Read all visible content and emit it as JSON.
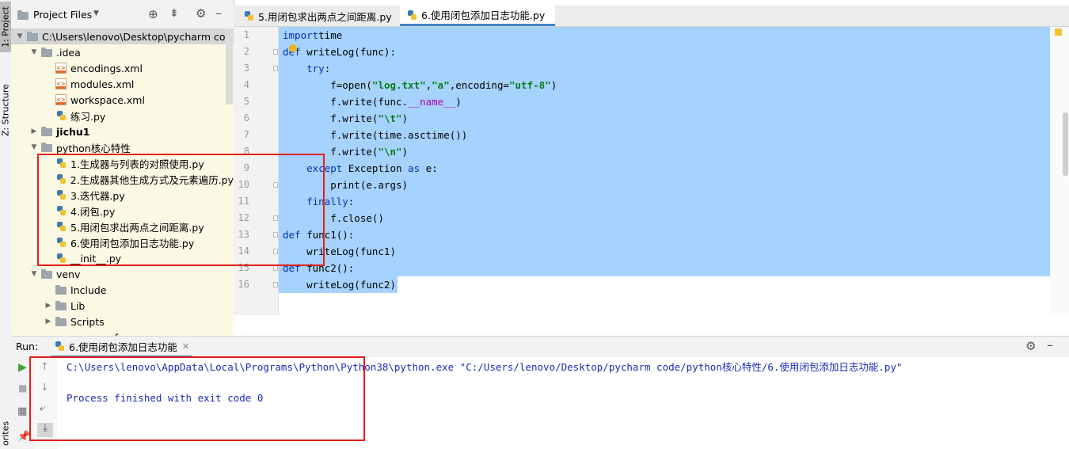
{
  "left_strip": {
    "project_tab": "1: Project",
    "structure_tab": "Z: Structure",
    "favorites_tab": "orites"
  },
  "project_panel": {
    "title": "Project Files",
    "tree": [
      {
        "label": "C:\\Users\\lenovo\\Desktop\\pycharm cod",
        "icon": "folder-icon",
        "indent": 0,
        "arrow": "down",
        "selected": true
      },
      {
        "label": ".idea",
        "icon": "folder-icon",
        "indent": 1,
        "arrow": "down"
      },
      {
        "label": "encodings.xml",
        "icon": "xml-file-icon",
        "indent": 2,
        "arrow": ""
      },
      {
        "label": "modules.xml",
        "icon": "xml-file-icon",
        "indent": 2,
        "arrow": ""
      },
      {
        "label": "workspace.xml",
        "icon": "xml-file-icon",
        "indent": 2,
        "arrow": ""
      },
      {
        "label": "练习.py",
        "icon": "python-file-icon",
        "indent": 2,
        "arrow": ""
      },
      {
        "label": "jichu1",
        "icon": "folder-icon",
        "indent": 1,
        "arrow": "right",
        "bold": true
      },
      {
        "label": "python核心特性",
        "icon": "folder-icon",
        "indent": 1,
        "arrow": "down"
      },
      {
        "label": "1.生成器与列表的对照使用.py",
        "icon": "python-file-icon",
        "indent": 2,
        "arrow": ""
      },
      {
        "label": "2.生成器其他生成方式及元素遍历.py",
        "icon": "python-file-icon",
        "indent": 2,
        "arrow": ""
      },
      {
        "label": "3.迭代器.py",
        "icon": "python-file-icon",
        "indent": 2,
        "arrow": ""
      },
      {
        "label": "4.闭包.py",
        "icon": "python-file-icon",
        "indent": 2,
        "arrow": ""
      },
      {
        "label": "5.用闭包求出两点之间距离.py",
        "icon": "python-file-icon",
        "indent": 2,
        "arrow": ""
      },
      {
        "label": "6.使用闭包添加日志功能.py",
        "icon": "python-file-icon",
        "indent": 2,
        "arrow": ""
      },
      {
        "label": "__init__.py",
        "icon": "python-file-icon",
        "indent": 2,
        "arrow": ""
      },
      {
        "label": "venv",
        "icon": "folder-icon",
        "indent": 1,
        "arrow": "down"
      },
      {
        "label": "Include",
        "icon": "folder-icon",
        "indent": 2,
        "arrow": ""
      },
      {
        "label": "Lib",
        "icon": "folder-icon",
        "indent": 2,
        "arrow": "right"
      },
      {
        "label": "Scripts",
        "icon": "folder-icon",
        "indent": 2,
        "arrow": "right"
      },
      {
        "label": "pyvenv.cfg",
        "icon": "file-icon",
        "indent": 2,
        "arrow": ""
      }
    ]
  },
  "editor": {
    "tabs": [
      {
        "label": "5.用闭包求出两点之间距离.py",
        "active": false
      },
      {
        "label": "6.使用闭包添加日志功能.py",
        "active": true
      }
    ],
    "lines": [
      [
        [
          "kw",
          "import"
        ],
        [
          "",
          "time"
        ]
      ],
      [
        [
          "kw",
          "def"
        ],
        [
          "",
          " writeLog(func):"
        ]
      ],
      [
        [
          "",
          "    "
        ],
        [
          "kw",
          "try"
        ],
        [
          "",
          ":"
        ]
      ],
      [
        [
          "",
          "        f=open("
        ],
        [
          "st",
          "\"log.txt\""
        ],
        [
          "",
          ","
        ],
        [
          "st",
          "\"a\""
        ],
        [
          "",
          ",encoding="
        ],
        [
          "st",
          "\"utf-8\""
        ],
        [
          "",
          ")"
        ]
      ],
      [
        [
          "",
          "        f.write(func."
        ],
        [
          "dn",
          "__name__"
        ],
        [
          "",
          ")"
        ]
      ],
      [
        [
          "",
          "        f.write("
        ],
        [
          "st",
          "\"\\t\""
        ],
        [
          "",
          ")"
        ]
      ],
      [
        [
          "",
          "        f.write(time.asctime())"
        ]
      ],
      [
        [
          "",
          "        f.write("
        ],
        [
          "st",
          "\"\\n\""
        ],
        [
          "",
          ")"
        ]
      ],
      [
        [
          "",
          "    "
        ],
        [
          "kw",
          "except"
        ],
        [
          "",
          "",
          " Exception "
        ],
        [
          "kw",
          "as"
        ],
        [
          "",
          " e:"
        ]
      ],
      [
        [
          "",
          "        print(e.args)"
        ]
      ],
      [
        [
          "",
          "    "
        ],
        [
          "kw",
          "finally"
        ],
        [
          "",
          ":"
        ]
      ],
      [
        [
          "",
          "        f.close()"
        ]
      ],
      [
        [
          "kw",
          "def"
        ],
        [
          "",
          " func1():"
        ]
      ],
      [
        [
          "",
          "    writeLog(func1)"
        ]
      ],
      [
        [
          "kw",
          "def"
        ],
        [
          "",
          " func2():"
        ]
      ],
      [
        [
          "",
          "    writeLog(func2)"
        ]
      ]
    ]
  },
  "run_panel": {
    "label": "Run:",
    "tab": "6.使用闭包添加日志功能",
    "console": [
      "C:\\Users\\lenovo\\AppData\\Local\\Programs\\Python\\Python38\\python.exe \"C:/Users/lenovo/Desktop/pycharm code/python核心特性/6.使用闭包添加日志功能.py\"",
      "",
      "Process finished with exit code 0"
    ]
  }
}
